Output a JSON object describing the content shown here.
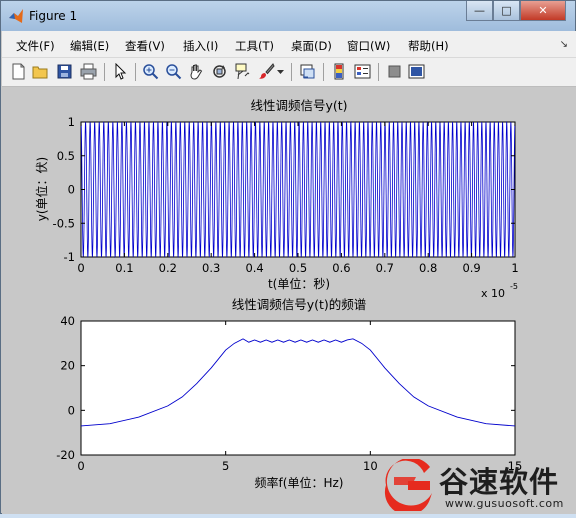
{
  "window": {
    "title": "Figure 1",
    "min_glyph": "—",
    "max_glyph": "□",
    "close_glyph": "✕"
  },
  "menubar": {
    "items": [
      "文件(F)",
      "编辑(E)",
      "查看(V)",
      "插入(I)",
      "工具(T)",
      "桌面(D)",
      "窗口(W)",
      "帮助(H)"
    ],
    "corner_glyph": "↘"
  },
  "toolbar": {
    "icons": [
      "new-figure-icon",
      "open-file-icon",
      "save-icon",
      "print-icon",
      "pointer-icon",
      "zoom-in-icon",
      "zoom-out-icon",
      "pan-hand-icon",
      "rotate-3d-icon",
      "data-cursor-icon",
      "brush-icon",
      "brush-dropdown-icon",
      "link-plot-icon",
      "colorbar-icon",
      "legend-icon",
      "hide-plot-tools-icon",
      "show-plot-tools-icon"
    ]
  },
  "colors": {
    "signal": "#0000cc",
    "axes_bg": "#ffffff",
    "figure_bg": "#c8c8c8"
  },
  "plot1": {
    "title": "线性调频信号y(t)",
    "xlabel": "t(单位：秒)",
    "ylabel": "y(单位：伏)",
    "exponent_base": "x 10",
    "exponent_power": "-5",
    "xticks": [
      "0",
      "0.1",
      "0.2",
      "0.3",
      "0.4",
      "0.5",
      "0.6",
      "0.7",
      "0.8",
      "0.9",
      "1"
    ],
    "yticks": [
      "1",
      "0.5",
      "0",
      "-0.5",
      "-1"
    ]
  },
  "plot2": {
    "title": "线性调频信号y(t)的频谱",
    "xlabel": "频率f(单位：Hz)",
    "xticks": [
      "0",
      "5",
      "10",
      "15"
    ],
    "yticks": [
      "40",
      "20",
      "0",
      "-20"
    ]
  },
  "chart_data": [
    {
      "type": "line",
      "title": "线性调频信号y(t)",
      "xlabel": "t(单位：秒)",
      "ylabel": "y(单位：伏)",
      "xlim": [
        0,
        1
      ],
      "x_multiplier": "1e-5",
      "ylim": [
        -1,
        1
      ],
      "grid": false,
      "signal": {
        "kind": "linear chirp",
        "amplitude": 1,
        "start_cycles_per_unit": 95,
        "end_cycles_per_unit": 105
      }
    },
    {
      "type": "line",
      "title": "线性调频信号y(t)的频谱",
      "xlabel": "频率f(单位：Hz)",
      "ylabel": "",
      "xlim": [
        0,
        15
      ],
      "ylim": [
        -20,
        40
      ],
      "grid": false,
      "x": [
        0,
        1,
        2,
        3,
        3.5,
        4,
        4.5,
        5,
        5.3,
        5.6,
        5.8,
        6.0,
        6.2,
        6.4,
        6.6,
        6.8,
        7.0,
        7.2,
        7.4,
        7.6,
        7.8,
        8.0,
        8.2,
        8.4,
        8.6,
        8.8,
        9.0,
        9.2,
        9.4,
        9.7,
        10,
        10.5,
        11,
        11.5,
        12,
        13,
        14,
        15
      ],
      "y": [
        -7,
        -6,
        -3,
        2,
        6,
        12,
        19,
        27,
        30,
        32,
        30.5,
        31.5,
        30.5,
        31.5,
        30.5,
        31.5,
        30.5,
        31.5,
        30.5,
        31.5,
        30.5,
        31.5,
        30.5,
        31.5,
        30.5,
        31.5,
        30.5,
        31.5,
        32,
        30,
        27,
        19,
        12,
        6,
        2,
        -3,
        -6,
        -7
      ]
    }
  ],
  "watermark": {
    "name": "谷速软件",
    "url": "www.gusuosoft.com",
    "logo_color": "#e62b1e"
  }
}
